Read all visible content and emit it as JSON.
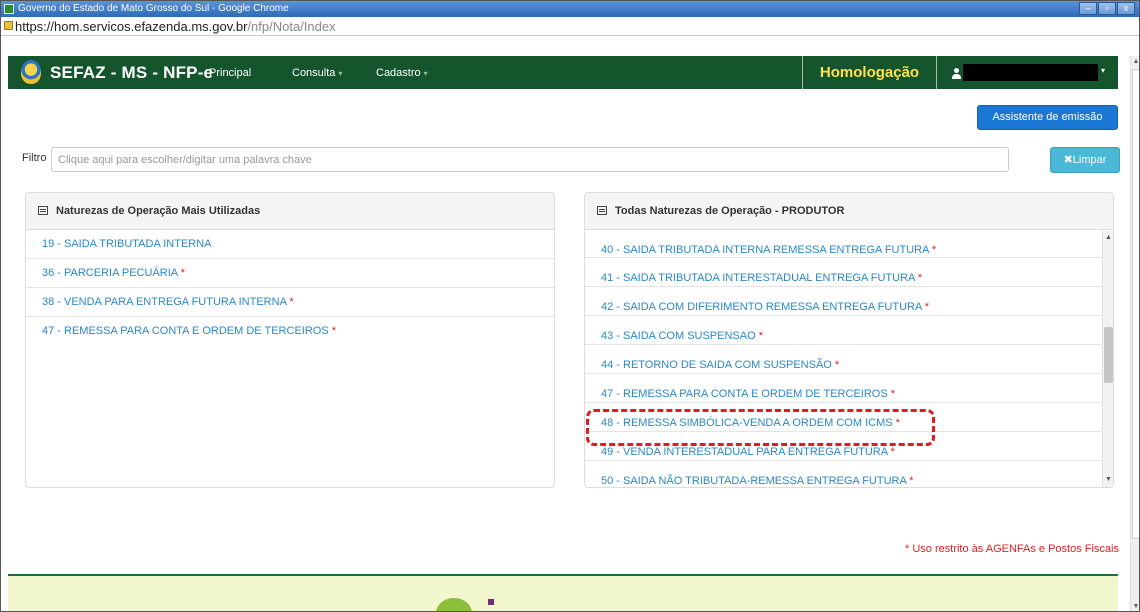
{
  "window": {
    "title": "Governo do Estado de Mato Grosso do Sul - Google Chrome",
    "controls": [
      "–",
      "▫",
      "x"
    ]
  },
  "addressbar": {
    "url_base": "https://hom.servicos.efazenda.ms.gov.br",
    "url_path": "/nfp/Nota/Index"
  },
  "navbar": {
    "brand": "SEFAZ - MS - NFP-e",
    "items": [
      {
        "label": "Principal",
        "caret": ""
      },
      {
        "label": "Consulta",
        "caret": "▾"
      },
      {
        "label": "Cadastro",
        "caret": "▾"
      }
    ],
    "environment": "Homologação",
    "user_caret": "▾"
  },
  "toolbar": {
    "assistant_button": "Assistente de emissão"
  },
  "filter": {
    "label": "Filtro",
    "placeholder": "Clique aqui para escolher/digitar uma palavra chave",
    "clear_button": "Limpar",
    "clear_icon": "✖"
  },
  "left_panel": {
    "title": "Naturezas de Operação Mais Utilizadas",
    "items": [
      {
        "label": "19 - SAIDA TRIBUTADA INTERNA",
        "restricted": ""
      },
      {
        "label": "36 - PARCERIA PECUÁRIA",
        "restricted": "*"
      },
      {
        "label": "38 - VENDA PARA ENTREGA FUTURA INTERNA",
        "restricted": "*"
      },
      {
        "label": "47 - REMESSA PARA CONTA E ORDEM DE TERCEIROS",
        "restricted": "*"
      }
    ]
  },
  "right_panel": {
    "title": "Todas Naturezas de Operação - PRODUTOR",
    "items": [
      {
        "label": "40 - SAIDA TRIBUTADA INTERNA REMESSA ENTREGA FUTURA",
        "restricted": "*"
      },
      {
        "label": "41 - SAIDA TRIBUTADA INTERESTADUAL ENTREGA FUTURA",
        "restricted": "*"
      },
      {
        "label": "42 - SAIDA COM DIFERIMENTO REMESSA ENTREGA FUTURA",
        "restricted": "*"
      },
      {
        "label": "43 - SAIDA COM SUSPENSAO",
        "restricted": "*"
      },
      {
        "label": "44 - RETORNO DE SAIDA COM SUSPENSÃO",
        "restricted": "*"
      },
      {
        "label": "47 - REMESSA PARA CONTA E ORDEM DE TERCEIROS",
        "restricted": "*"
      },
      {
        "label": "48 - REMESSA SIMBÓLICA-VENDA A ORDEM COM ICMS",
        "restricted": "*"
      },
      {
        "label": "49 - VENDA INTERESTADUAL PARA ENTREGA FUTURA",
        "restricted": "*"
      },
      {
        "label": "50 - SAIDA NÃO TRIBUTADA-REMESSA ENTREGA FUTURA",
        "restricted": "*"
      }
    ],
    "highlighted_item": "48 - REMESSA SIMBÓLICA-VENDA A ORDEM COM ICMS"
  },
  "notice": "* Uso restrito às AGENFAs e Postos Fiscais",
  "colors": {
    "navbar": "#15552d",
    "environment": "#ffe14a",
    "link": "#2a88c8",
    "required": "#e02020",
    "primary_button": "#1a78d4",
    "info_button": "#4bb8d8",
    "highlight": "#e41b1b"
  },
  "icons": {
    "lock": "lock-icon",
    "user": "user-icon",
    "list": "list-icon",
    "clear": "times-icon"
  }
}
